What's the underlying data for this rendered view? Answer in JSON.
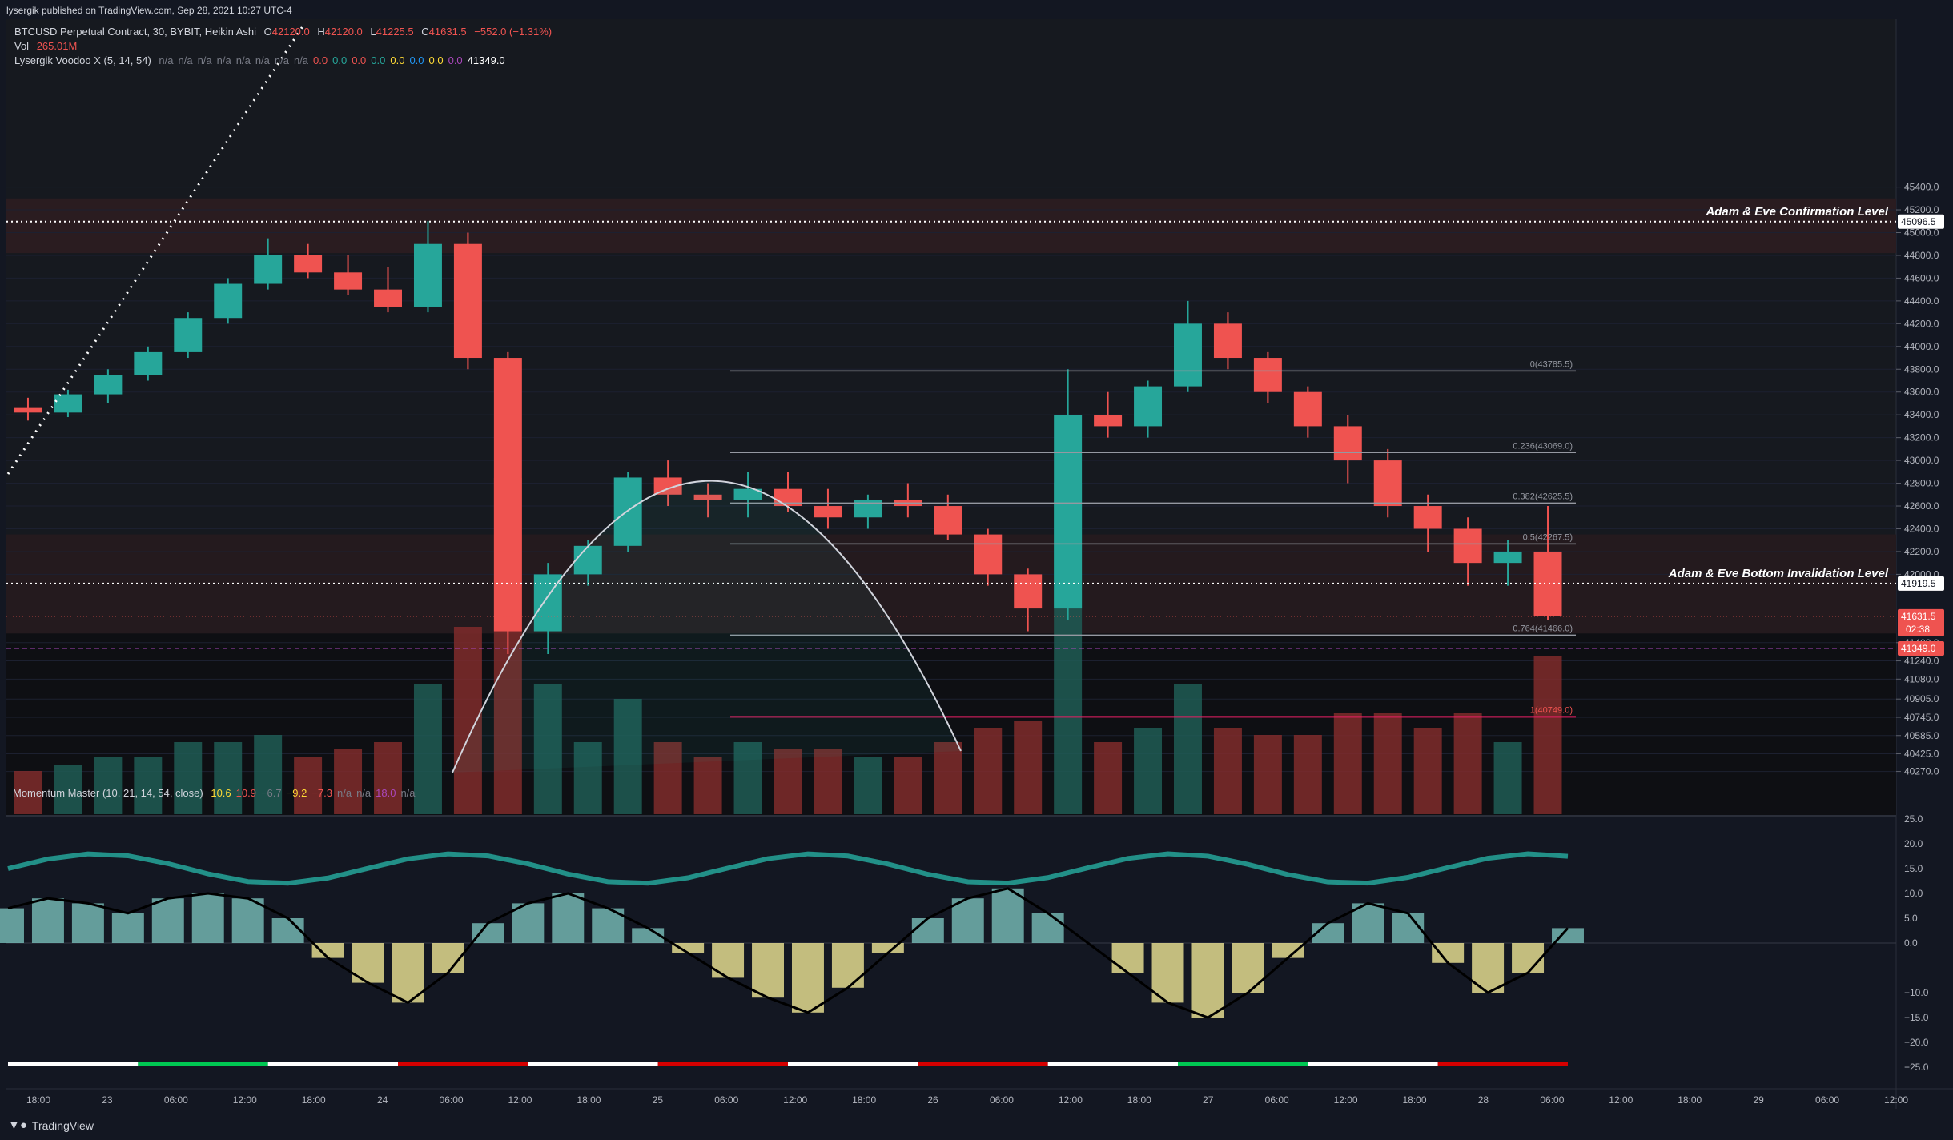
{
  "published": "lysergik published on TradingView.com, Sep 28, 2021 10:27 UTC-4",
  "legend": {
    "symbol": "BTCUSD Perpetual Contract, 30, BYBIT, Heikin Ashi",
    "o_label": "O",
    "o": "42120.0",
    "h_label": "H",
    "h": "42120.0",
    "l_label": "L",
    "l": "41225.5",
    "c_label": "C",
    "c": "41631.5",
    "chg": "−552.0 (−1.31%)",
    "vol_label": "Vol",
    "vol": "265.01M",
    "voodoo_label": "Lysergik Voodoo X (5, 14, 54)",
    "voodoo_vals": [
      "n/a",
      "n/a",
      "n/a",
      "n/a",
      "n/a",
      "n/a",
      "n/a",
      "n/a",
      "0.0",
      "0.0",
      "0.0",
      "0.0",
      "0.0",
      "0.0",
      "0.0",
      "0.0",
      "41349.0"
    ],
    "voodoo_colors": [
      "#787b86",
      "#787b86",
      "#787b86",
      "#787b86",
      "#787b86",
      "#787b86",
      "#787b86",
      "#787b86",
      "#ef5350",
      "#26a69a",
      "#ef5350",
      "#26a69a",
      "#fdd835",
      "#2196f3",
      "#fdd835",
      "#ab47bc",
      "#ffffff"
    ],
    "mm_label": "Momentum Master (10, 21, 14, 54, close)",
    "mm_vals": [
      "10.6",
      "10.9",
      "−6.7",
      "−9.2",
      "−7.3",
      "n/a",
      "n/a",
      "18.0",
      "n/a"
    ],
    "mm_colors": [
      "#fdd835",
      "#ef5350",
      "#787b86",
      "#fdd835",
      "#ef5350",
      "#787b86",
      "#787b86",
      "#ab47bc",
      "#787b86"
    ]
  },
  "annotations": {
    "confirmation": "Adam & Eve Confirmation Level",
    "invalidation": "Adam & Eve Bottom Invalidation Level"
  },
  "brand": "TradingView",
  "colors": {
    "background": "#131722",
    "up": "#26a69a",
    "down": "#ef5350",
    "accent": "#2962ff"
  },
  "chart_data": [
    {
      "type": "candlestick",
      "title": "BTCUSD Perpetual Contract, 30, BYBIT, Heikin Ashi",
      "y_ticks": [
        "45400.0",
        "45200.0",
        "45000.0",
        "44800.0",
        "44600.0",
        "44400.0",
        "44200.0",
        "44000.0",
        "43800.0",
        "43600.0",
        "43400.0",
        "43200.0",
        "43000.0",
        "42800.0",
        "42600.0",
        "42400.0",
        "42200.0",
        "42000.0",
        "41400.0",
        "41240.0",
        "41080.0",
        "40905.0",
        "40745.0",
        "40585.0",
        "40425.0",
        "40270.0"
      ],
      "y_badges": [
        {
          "value": "45096.5",
          "color": "#ffffff"
        },
        {
          "value": "41919.5",
          "color": "#ffffff"
        },
        {
          "value": "41631.5",
          "sub": "02:38",
          "color": "#ef5350"
        },
        {
          "value": "41349.0",
          "color": "#ef5350"
        }
      ],
      "fib_levels": [
        {
          "label": "0(43785.5)",
          "value": 43785.5
        },
        {
          "label": "0.236(43069.0)",
          "value": 43069.0
        },
        {
          "label": "0.382(42625.5)",
          "value": 42625.5
        },
        {
          "label": "0.5(42267.5)",
          "value": 42267.5
        },
        {
          "label": "0.764(41466.0)",
          "value": 41466.0
        },
        {
          "label": "1(40749.0)",
          "value": 40749.0
        }
      ],
      "x_ticks": [
        "18:00",
        "23",
        "06:00",
        "12:00",
        "18:00",
        "24",
        "06:00",
        "12:00",
        "18:00",
        "25",
        "06:00",
        "12:00",
        "18:00",
        "26",
        "06:00",
        "12:00",
        "18:00",
        "27",
        "06:00",
        "12:00",
        "18:00",
        "28",
        "06:00",
        "12:00",
        "18:00",
        "29",
        "06:00",
        "12:00"
      ],
      "ohlc_approx": [
        [
          43460,
          43550,
          43350,
          43420
        ],
        [
          43420,
          43620,
          43380,
          43580
        ],
        [
          43580,
          43800,
          43500,
          43750
        ],
        [
          43750,
          44000,
          43700,
          43950
        ],
        [
          43950,
          44300,
          43900,
          44250
        ],
        [
          44250,
          44600,
          44200,
          44550
        ],
        [
          44550,
          44950,
          44500,
          44800
        ],
        [
          44800,
          44900,
          44600,
          44650
        ],
        [
          44650,
          44800,
          44450,
          44500
        ],
        [
          44500,
          44700,
          44300,
          44350
        ],
        [
          44350,
          45100,
          44300,
          44900
        ],
        [
          44900,
          45000,
          43800,
          43900
        ],
        [
          43900,
          43950,
          41300,
          41500
        ],
        [
          41500,
          42100,
          41300,
          42000
        ],
        [
          42000,
          42300,
          41900,
          42250
        ],
        [
          42250,
          42900,
          42200,
          42850
        ],
        [
          42850,
          43000,
          42600,
          42700
        ],
        [
          42700,
          42800,
          42500,
          42650
        ],
        [
          42650,
          42900,
          42500,
          42750
        ],
        [
          42750,
          42900,
          42550,
          42600
        ],
        [
          42600,
          42750,
          42400,
          42500
        ],
        [
          42500,
          42700,
          42400,
          42650
        ],
        [
          42650,
          42800,
          42500,
          42600
        ],
        [
          42600,
          42700,
          42300,
          42350
        ],
        [
          42350,
          42400,
          41900,
          42000
        ],
        [
          42000,
          42050,
          41500,
          41700
        ],
        [
          41700,
          43800,
          41600,
          43400
        ],
        [
          43400,
          43600,
          43200,
          43300
        ],
        [
          43300,
          43700,
          43200,
          43650
        ],
        [
          43650,
          44400,
          43600,
          44200
        ],
        [
          44200,
          44300,
          43800,
          43900
        ],
        [
          43900,
          43950,
          43500,
          43600
        ],
        [
          43600,
          43650,
          43200,
          43300
        ],
        [
          43300,
          43400,
          42800,
          43000
        ],
        [
          43000,
          43100,
          42500,
          42600
        ],
        [
          42600,
          42700,
          42200,
          42400
        ],
        [
          42400,
          42500,
          41900,
          42100
        ],
        [
          42100,
          42300,
          41900,
          42200
        ],
        [
          42200,
          42600,
          41600,
          41631.5
        ]
      ],
      "annotation_labels": [
        "Adam & Eve Confirmation Level",
        "Adam & Eve Bottom Invalidation Level"
      ]
    },
    {
      "type": "area",
      "title": "Momentum Master (10, 21, 14, 54, close)",
      "y_ticks": [
        "25.0",
        "20.0",
        "15.0",
        "10.0",
        "5.0",
        "0.0",
        "−10.0",
        "−15.0",
        "−20.0",
        "−25.0"
      ],
      "y_range": [
        -27,
        25
      ],
      "osc_approx": [
        7,
        9,
        8,
        6,
        9,
        10,
        9,
        5,
        -3,
        -8,
        -12,
        -6,
        4,
        8,
        10,
        7,
        3,
        -2,
        -7,
        -11,
        -14,
        -9,
        -2,
        5,
        9,
        11,
        6,
        0,
        -6,
        -12,
        -15,
        -10,
        -3,
        4,
        8,
        6,
        -4,
        -10,
        -6,
        3
      ]
    }
  ]
}
